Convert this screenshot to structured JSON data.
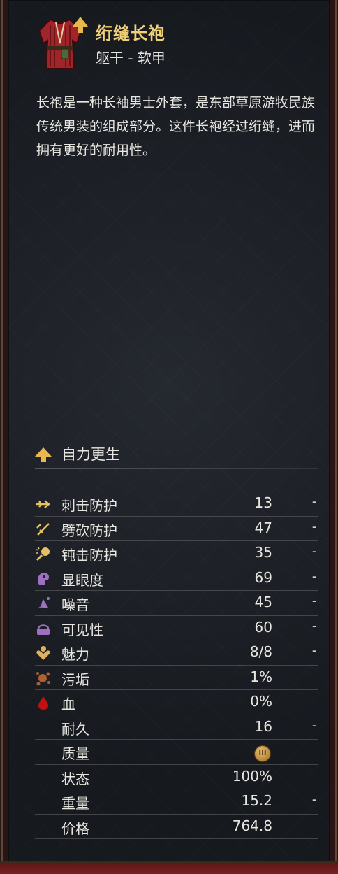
{
  "item": {
    "name": "绗缝长袍",
    "type": "躯干 - 软甲",
    "description": "长袍是一种长袖男士外套，是东部草原游牧民族传统男装的组成部分。这件长袍经过绗缝，进而拥有更好的耐用性。",
    "icon": "red-robe-icon",
    "upgrade_icon": "upgrade-arrow-icon"
  },
  "perk": {
    "label": "自力更生",
    "icon": "upgrade-arrow-icon"
  },
  "stats": [
    {
      "label": "刺击防护",
      "value": "13",
      "delta": "-",
      "icon": "stab-protection-icon",
      "color": "#e8c060"
    },
    {
      "label": "劈砍防护",
      "value": "47",
      "delta": "-",
      "icon": "slash-protection-icon",
      "color": "#e8c060"
    },
    {
      "label": "钝击防护",
      "value": "35",
      "delta": "-",
      "icon": "blunt-protection-icon",
      "color": "#e8c060"
    },
    {
      "label": "显眼度",
      "value": "69",
      "delta": "-",
      "icon": "conspicuousness-icon",
      "color": "#a070c0"
    },
    {
      "label": "噪音",
      "value": "45",
      "delta": "-",
      "icon": "noise-icon",
      "color": "#a070c0"
    },
    {
      "label": "可见性",
      "value": "60",
      "delta": "-",
      "icon": "visibility-icon",
      "color": "#a070c0"
    },
    {
      "label": "魅力",
      "value": "8/8",
      "delta": "-",
      "icon": "charisma-icon",
      "color": "#e8c060"
    },
    {
      "label": "污垢",
      "value": "1%",
      "delta": "",
      "icon": "dirt-icon",
      "color": "#b06030"
    },
    {
      "label": "血",
      "value": "0%",
      "delta": "",
      "icon": "blood-icon",
      "color": "#c01010"
    },
    {
      "label": "耐久",
      "value": "16",
      "delta": "-",
      "icon": "",
      "color": ""
    },
    {
      "label": "质量",
      "value": "",
      "delta": "",
      "icon": "",
      "color": "",
      "quality_badge": "III"
    },
    {
      "label": "状态",
      "value": "100%",
      "delta": "",
      "icon": "",
      "color": ""
    },
    {
      "label": "重量",
      "value": "15.2",
      "delta": "-",
      "icon": "",
      "color": ""
    },
    {
      "label": "价格",
      "value": "764.8",
      "delta": "",
      "icon": "",
      "color": ""
    }
  ]
}
